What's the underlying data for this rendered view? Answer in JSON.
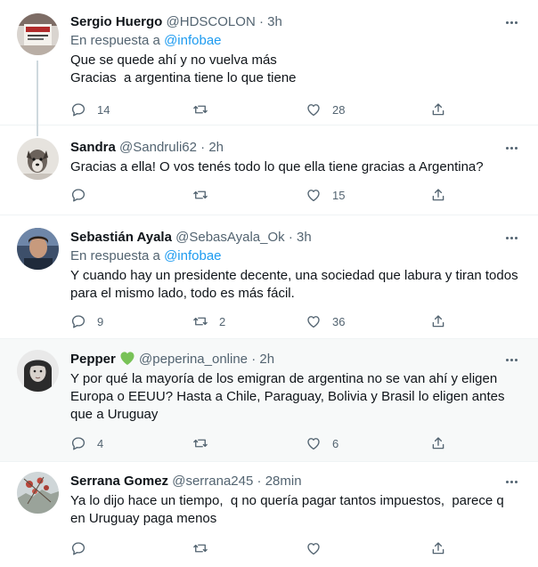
{
  "tweets": [
    {
      "name": "Sergio Huergo",
      "handle": "@HDSCOLON",
      "sep": "·",
      "time": "3h",
      "reply_prefix": "En respuesta a ",
      "reply_mention": "@infobae",
      "text": "Que se quede ahí y no vuelva más\nGracias  a argentina tiene lo que tiene",
      "replies": "14",
      "retweets": "",
      "likes": "28",
      "icons": [
        "more-icon",
        "reply-icon",
        "retweet-icon",
        "like-icon",
        "share-icon"
      ]
    },
    {
      "name": "Sandra",
      "handle": "@Sandruli62",
      "sep": "·",
      "time": "2h",
      "text": "Gracias a ella! O vos tenés todo lo que ella tiene gracias a Argentina?",
      "replies": "",
      "retweets": "",
      "likes": "15"
    },
    {
      "name": "Sebastián Ayala",
      "handle": "@SebasAyala_Ok",
      "sep": "·",
      "time": "3h",
      "reply_prefix": "En respuesta a ",
      "reply_mention": "@infobae",
      "text": "Y cuando hay un presidente decente, una sociedad que labura y tiran todos para el mismo lado, todo es más fácil.",
      "replies": "9",
      "retweets": "2",
      "likes": "36"
    },
    {
      "name": "Pepper",
      "handle": "@peperina_online",
      "sep": "·",
      "time": "2h",
      "text": "Y por qué la mayoría de los emigran de argentina no se van ahí y eligen Europa o EEUU? Hasta a Chile, Paraguay, Bolivia y Brasil lo eligen antes que a Uruguay",
      "replies": "4",
      "retweets": "",
      "likes": "6",
      "badge_color": "#78c257"
    },
    {
      "name": "Serrana Gomez",
      "handle": "@serrana245",
      "sep": "·",
      "time": "28min",
      "text": "Ya lo dijo hace un tiempo,  q no quería pagar tantos impuestos,  parece q en Uruguay paga menos",
      "replies": "",
      "retweets": "",
      "likes": ""
    }
  ]
}
